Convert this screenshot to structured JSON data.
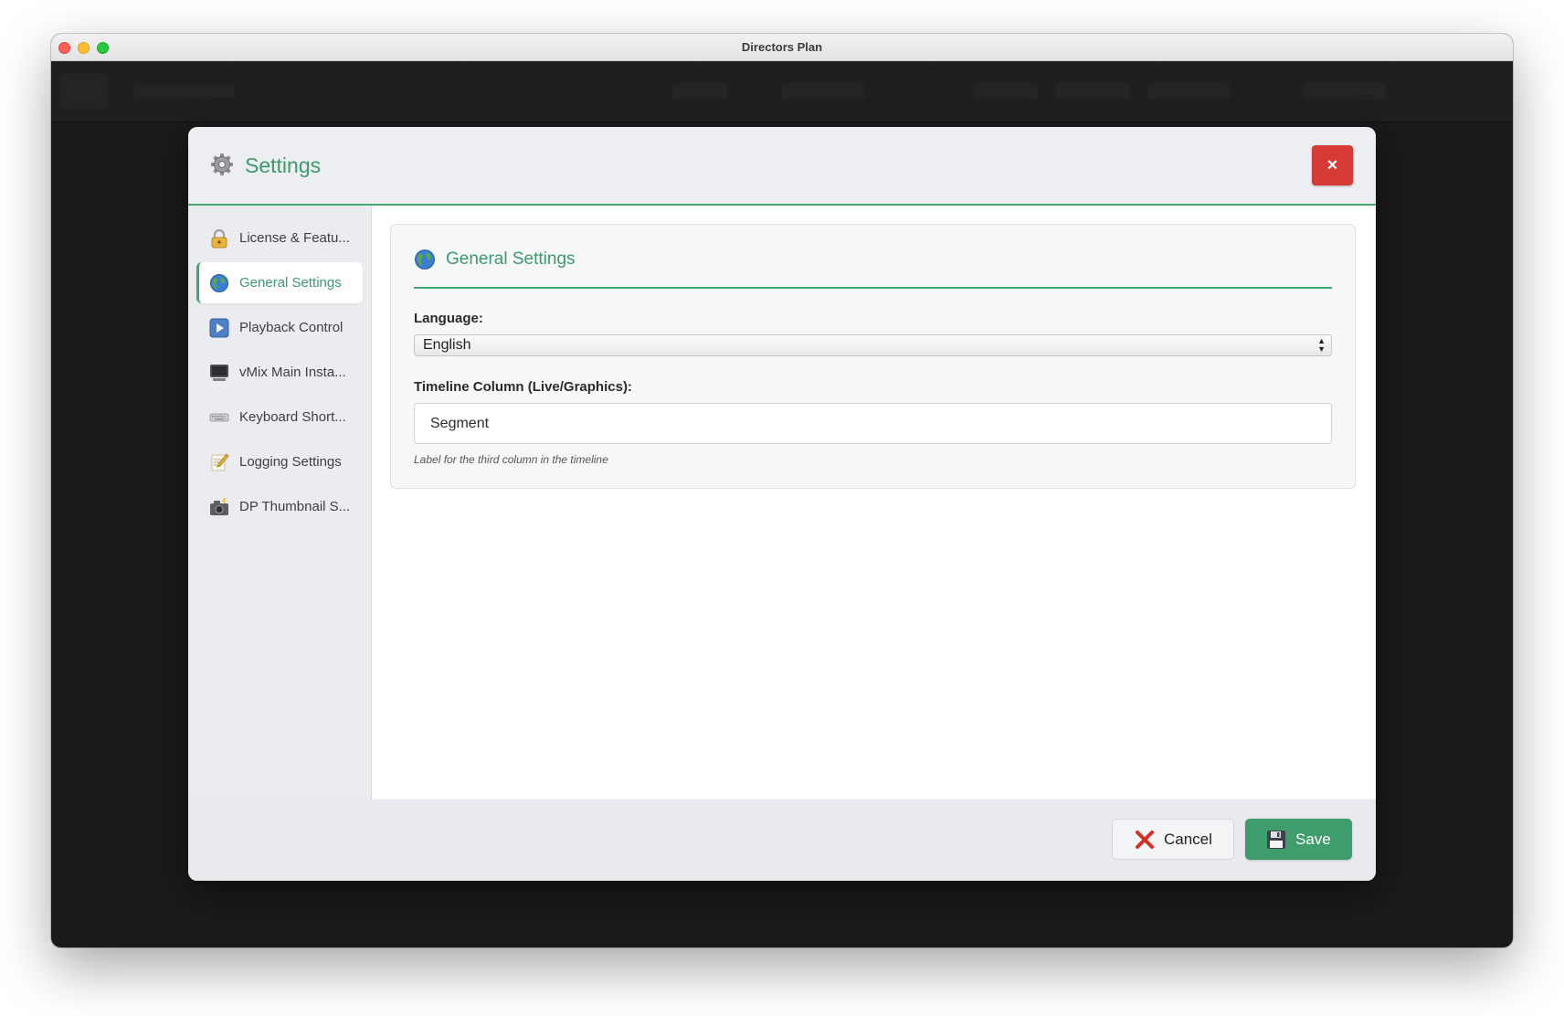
{
  "window": {
    "title": "Directors Plan"
  },
  "modal": {
    "title": "Settings",
    "close_label": "×",
    "sidebar": {
      "items": [
        {
          "label": "License & Featu...",
          "icon": "lock-key-icon"
        },
        {
          "label": "General Settings",
          "icon": "globe-icon",
          "active": true
        },
        {
          "label": "Playback Control",
          "icon": "play-button-icon"
        },
        {
          "label": "vMix Main Insta...",
          "icon": "computer-icon"
        },
        {
          "label": "Keyboard Short...",
          "icon": "keyboard-icon"
        },
        {
          "label": "Logging Settings",
          "icon": "memo-icon"
        },
        {
          "label": "DP Thumbnail S...",
          "icon": "camera-flash-icon"
        }
      ]
    },
    "panel": {
      "title": "General Settings",
      "language_label": "Language:",
      "language_value": "English",
      "timeline_label": "Timeline Column (Live/Graphics):",
      "timeline_value": "Segment",
      "timeline_hint": "Label for the third column in the timeline"
    },
    "footer": {
      "cancel_label": "Cancel",
      "save_label": "Save"
    }
  },
  "colors": {
    "accent_green": "#3fa772",
    "close_red": "#d63a35",
    "save_green": "#3f9c6c"
  }
}
